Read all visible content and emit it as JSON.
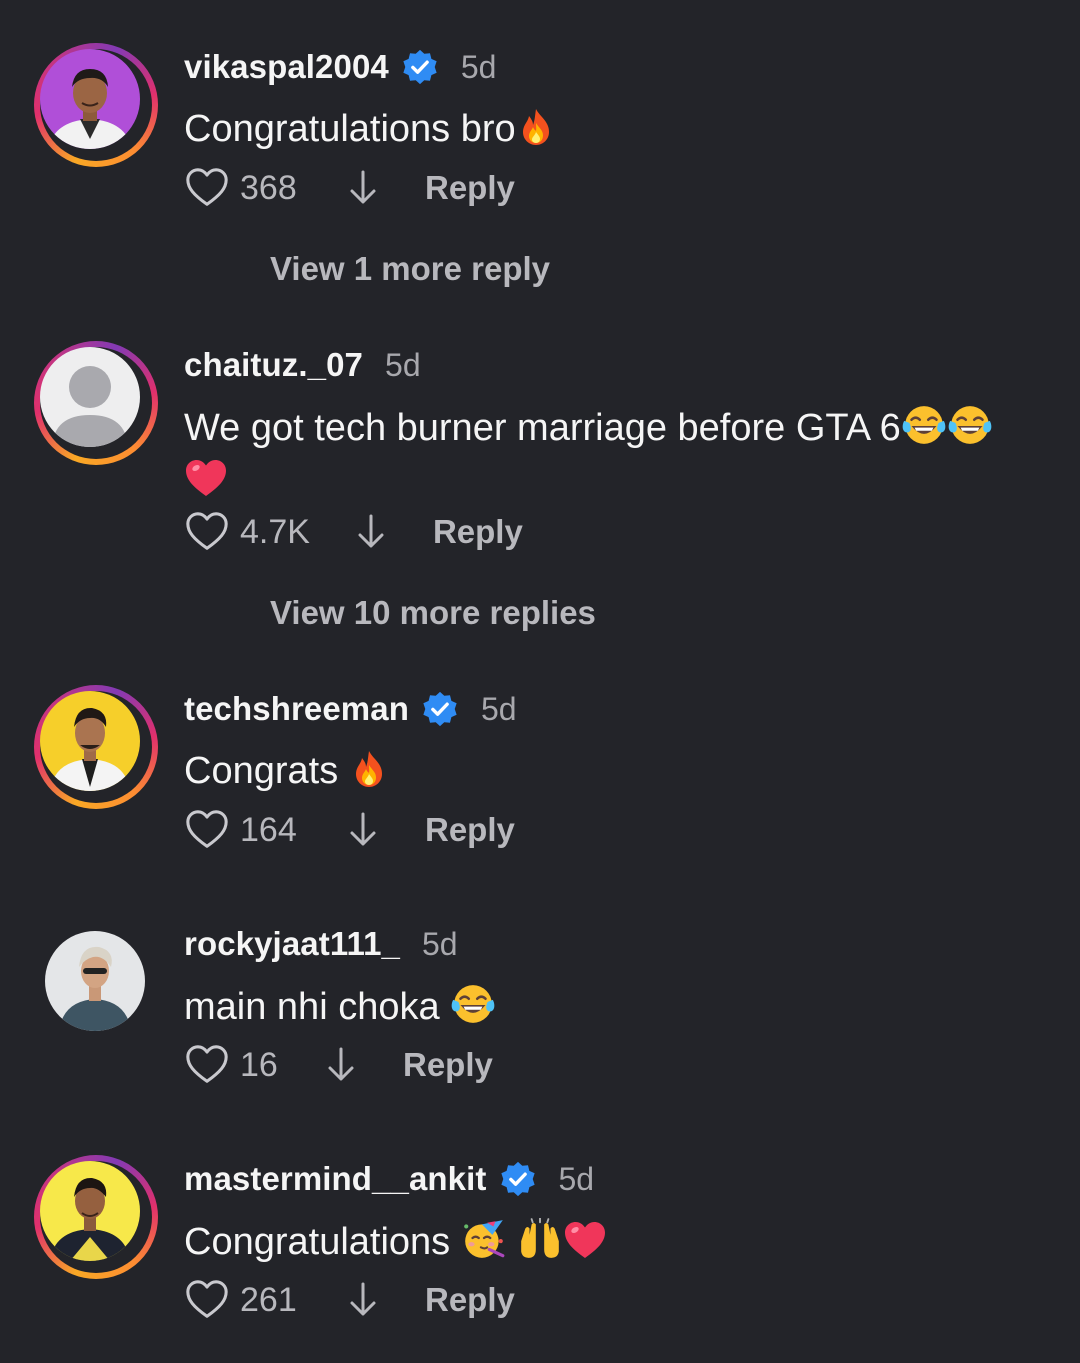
{
  "comments": [
    {
      "username": "vikaspal2004",
      "verified": true,
      "time": "5d",
      "text": "Congratulations bro",
      "emojis": [
        "fire"
      ],
      "likes": "368",
      "reply_label": "Reply",
      "view_more": "View 1 more reply"
    },
    {
      "username": "chaituz._07",
      "verified": false,
      "time": "5d",
      "text": "We got tech burner marriage before GTA 6",
      "emojis": [
        "tears-of-joy",
        "tears-of-joy",
        "red-heart"
      ],
      "likes": "4.7K",
      "reply_label": "Reply",
      "view_more": "View 10 more replies"
    },
    {
      "username": "techshreeman",
      "verified": true,
      "time": "5d",
      "text": "Congrats ",
      "emojis": [
        "fire"
      ],
      "likes": "164",
      "reply_label": "Reply"
    },
    {
      "username": "rockyjaat111_",
      "verified": false,
      "time": "5d",
      "text": "main nhi choka ",
      "emojis": [
        "tears-of-joy"
      ],
      "likes": "16",
      "reply_label": "Reply"
    },
    {
      "username": "mastermind__ankit",
      "verified": true,
      "time": "5d",
      "text": "Congratulations ",
      "emojis": [
        "partying-face",
        "raising-hands",
        "red-heart"
      ],
      "likes": "261",
      "reply_label": "Reply"
    }
  ],
  "colors": {
    "background": "#232429",
    "verified_badge": "#2f8cf4",
    "secondary_text": "#b8b8bd"
  }
}
